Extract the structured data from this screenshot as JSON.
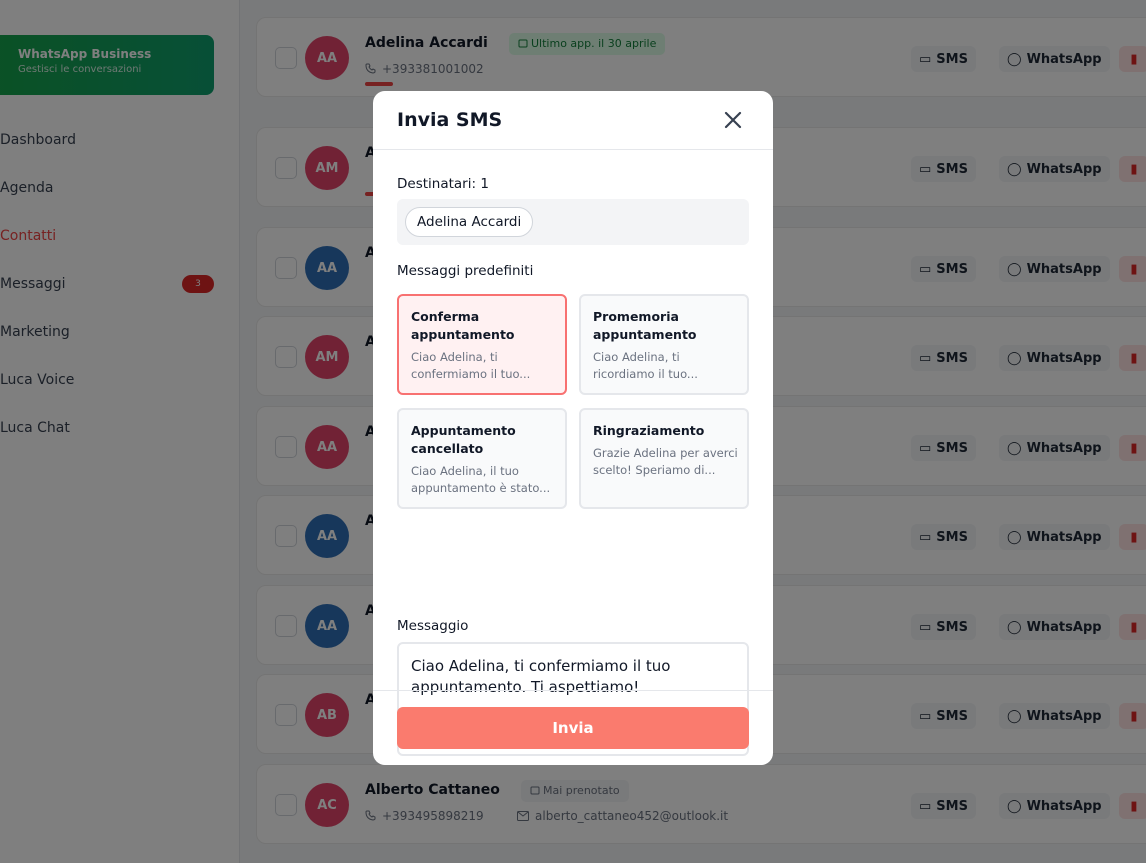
{
  "sidebar": {
    "whatsapp_card": {
      "title": "WhatsApp Business",
      "subtitle": "Gestisci le conversazioni"
    },
    "items": [
      {
        "label": "Dashboard"
      },
      {
        "label": "Agenda"
      },
      {
        "label": "Contatti"
      },
      {
        "label": "Messaggi",
        "badge": "3"
      },
      {
        "label": "Marketing"
      },
      {
        "label": "Luca Voice"
      },
      {
        "label": "Luca Chat"
      }
    ]
  },
  "contacts": {
    "sms_label": "SMS",
    "whatsapp_label": "WhatsApp",
    "rows": [
      {
        "initials": "AA",
        "name": "Adelina Accardi",
        "tag": "Ultimo app. il 30 aprile",
        "phone": "+393381001002",
        "email": ""
      },
      {
        "initials": "AM",
        "name": "A",
        "tag": "",
        "phone": "",
        "email": ""
      },
      {
        "initials": "AA",
        "name": "A",
        "tag": "",
        "phone": "",
        "email": ""
      },
      {
        "initials": "AM",
        "name": "A",
        "tag": "",
        "phone": "",
        "email": ""
      },
      {
        "initials": "AA",
        "name": "A",
        "tag": "",
        "phone": "",
        "email": ""
      },
      {
        "initials": "AA",
        "name": "A",
        "tag": "",
        "phone": "",
        "email": ""
      },
      {
        "initials": "AA",
        "name": "A",
        "tag": "",
        "phone": "",
        "email": ""
      },
      {
        "initials": "AB",
        "name": "A",
        "tag": "",
        "phone": "",
        "email": ""
      },
      {
        "initials": "AC",
        "name": "Alberto Cattaneo",
        "tag": "Mai prenotato",
        "phone": "+393495898219",
        "email": "alberto_cattaneo452@outlook.it"
      }
    ]
  },
  "modal": {
    "title": "Invia SMS",
    "recipients_label": "Destinatari: 1",
    "recipients": [
      "Adelina Accardi"
    ],
    "templates_label": "Messaggi predefiniti",
    "templates": [
      {
        "title": "Conferma appuntamento",
        "preview": "Ciao Adelina, ti confermiamo il tuo...",
        "selected": true
      },
      {
        "title": "Promemoria appuntamento",
        "preview": "Ciao Adelina, ti ricordiamo il tuo...",
        "selected": false
      },
      {
        "title": "Appuntamento cancellato",
        "preview": "Ciao Adelina, il tuo appuntamento è stato...",
        "selected": false
      },
      {
        "title": "Ringraziamento",
        "preview": "Grazie Adelina per averci scelto! Speriamo di...",
        "selected": false
      }
    ],
    "message_label": "Messaggio",
    "message_value": "Ciao Adelina, ti confermiamo il tuo appuntamento. Ti aspettiamo!",
    "send_label": "Invia"
  },
  "colors": {
    "accent": "#fa7b6e",
    "selected_border": "#f87171",
    "whatsapp_green": "#16a34a",
    "avatar_pink": "#e2456a",
    "avatar_blue": "#2f6fb6"
  }
}
